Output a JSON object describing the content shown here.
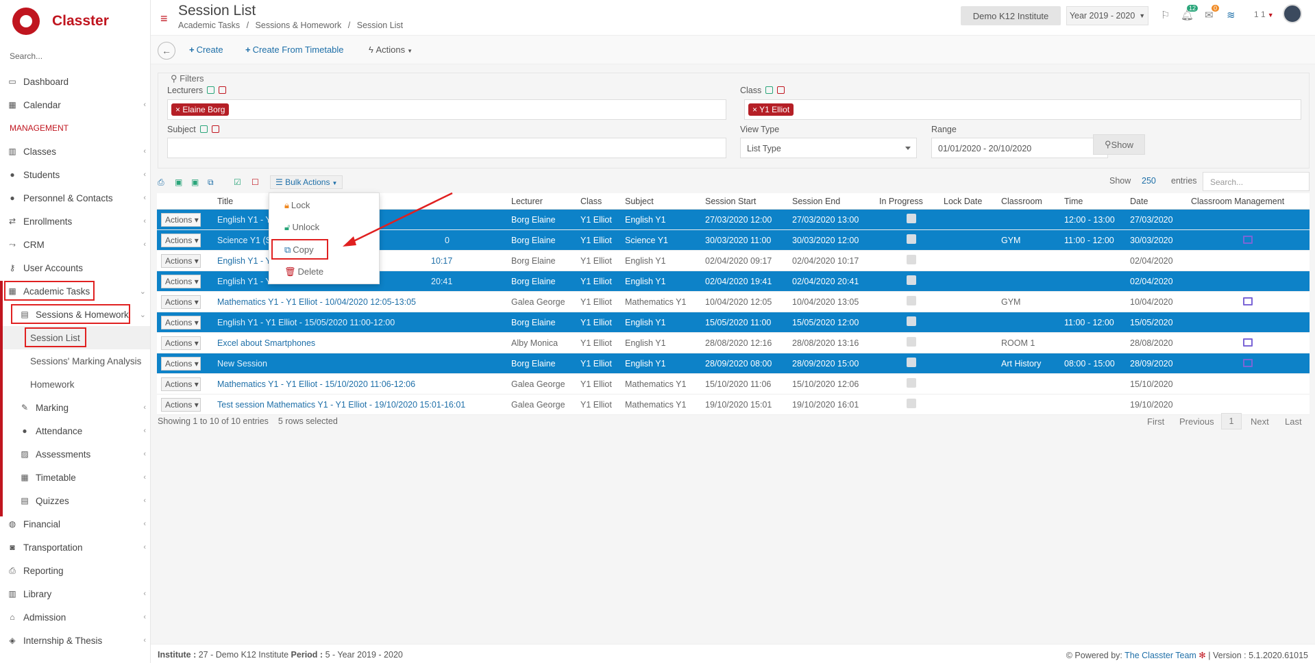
{
  "brand": {
    "name": "Classter",
    "search_placeholder": "Search...",
    "accent": "#c0151f"
  },
  "sidebar": {
    "dashboard": "Dashboard",
    "calendar": "Calendar",
    "section": "MANAGEMENT",
    "classes": "Classes",
    "students": "Students",
    "personnel": "Personnel & Contacts",
    "enrollments": "Enrollments",
    "crm": "CRM",
    "user_accounts": "User Accounts",
    "academic_tasks": "Academic Tasks",
    "sessions_homework": "Sessions & Homework",
    "session_list": "Session List",
    "marking_analysis": "Sessions' Marking Analysis",
    "homework": "Homework",
    "marking": "Marking",
    "attendance": "Attendance",
    "assessments": "Assessments",
    "timetable": "Timetable",
    "quizzes": "Quizzes",
    "financial": "Financial",
    "transportation": "Transportation",
    "reporting": "Reporting",
    "library": "Library",
    "admission": "Admission",
    "internship": "Internship & Thesis"
  },
  "header": {
    "title": "Session List",
    "breadcrumbs": [
      "Academic Tasks",
      "/",
      "Sessions & Homework",
      "/",
      "Session List"
    ],
    "institute": "Demo K12 Institute",
    "year": "Year 2019 - 2020",
    "notif_count": "12",
    "msg_count": "0",
    "user": "1 1"
  },
  "toolbar": {
    "create": "Create",
    "create_from_timetable": "Create From Timetable",
    "actions": "Actions"
  },
  "filters": {
    "title": "Filters",
    "lecturers_label": "Lecturers",
    "lecturer_tag": "Elaine Borg",
    "class_label": "Class",
    "class_tag": "Y1 Elliot",
    "subject_label": "Subject",
    "view_type_label": "View Type",
    "view_type_value": "List Type",
    "range_label": "Range",
    "range_value": "01/01/2020 - 20/10/2020",
    "show_button": "Show"
  },
  "table_tools": {
    "bulk_actions": "Bulk Actions",
    "show": "Show",
    "page_size": "250",
    "entries": "entries",
    "search_placeholder": "Search..."
  },
  "bulk_menu": [
    "Lock",
    "Unlock",
    "Copy",
    "Delete"
  ],
  "columns": [
    "Title",
    "Lecturer",
    "Class",
    "Subject",
    "Session Start",
    "Session End",
    "In Progress",
    "Lock Date",
    "Classroom",
    "Time",
    "Date",
    "Classroom Management"
  ],
  "rows": [
    {
      "sel": true,
      "title": "English Y1 - Y",
      "lecturer": "Borg Elaine",
      "class": "Y1 Elliot",
      "subject": "English Y1",
      "start": "27/03/2020 12:00",
      "end": "27/03/2020 13:00",
      "classroom": "",
      "time": "12:00 - 13:00",
      "date": "27/03/2020",
      "cm": false
    },
    {
      "sel": true,
      "title": "Science Y1 (S",
      "title_tail": "0",
      "lecturer": "Borg Elaine",
      "class": "Y1 Elliot",
      "subject": "Science Y1",
      "start": "30/03/2020 11:00",
      "end": "30/03/2020 12:00",
      "classroom": "GYM",
      "time": "11:00 - 12:00",
      "date": "30/03/2020",
      "cm": true
    },
    {
      "sel": false,
      "title": "English Y1 - Y",
      "title_tail": "10:17",
      "lecturer": "Borg Elaine",
      "class": "Y1 Elliot",
      "subject": "English Y1",
      "start": "02/04/2020 09:17",
      "end": "02/04/2020 10:17",
      "classroom": "",
      "time": "",
      "date": "02/04/2020",
      "cm": false
    },
    {
      "sel": true,
      "title": "English Y1 - Y",
      "title_tail": "20:41",
      "lecturer": "Borg Elaine",
      "class": "Y1 Elliot",
      "subject": "English Y1",
      "start": "02/04/2020 19:41",
      "end": "02/04/2020 20:41",
      "classroom": "",
      "time": "",
      "date": "02/04/2020",
      "cm": false
    },
    {
      "sel": false,
      "title": "Mathematics Y1 - Y1 Elliot - 10/04/2020 12:05-13:05",
      "lecturer": "Galea George",
      "class": "Y1 Elliot",
      "subject": "Mathematics Y1",
      "start": "10/04/2020 12:05",
      "end": "10/04/2020 13:05",
      "classroom": "GYM",
      "time": "",
      "date": "10/04/2020",
      "cm": true
    },
    {
      "sel": true,
      "title": "English Y1 - Y1 Elliot - 15/05/2020 11:00-12:00",
      "lecturer": "Borg Elaine",
      "class": "Y1 Elliot",
      "subject": "English Y1",
      "start": "15/05/2020 11:00",
      "end": "15/05/2020 12:00",
      "classroom": "",
      "time": "11:00 - 12:00",
      "date": "15/05/2020",
      "cm": false
    },
    {
      "sel": false,
      "title": "Excel about Smartphones",
      "lecturer": "Alby Monica",
      "class": "Y1 Elliot",
      "subject": "English Y1",
      "start": "28/08/2020 12:16",
      "end": "28/08/2020 13:16",
      "classroom": "ROOM 1",
      "time": "",
      "date": "28/08/2020",
      "cm": true
    },
    {
      "sel": true,
      "title": "New Session",
      "lecturer": "Borg Elaine",
      "class": "Y1 Elliot",
      "subject": "English Y1",
      "start": "28/09/2020 08:00",
      "end": "28/09/2020 15:00",
      "classroom": "Art History",
      "time": "08:00 - 15:00",
      "date": "28/09/2020",
      "cm": true
    },
    {
      "sel": false,
      "title": "Mathematics Y1 - Y1 Elliot - 15/10/2020 11:06-12:06",
      "lecturer": "Galea George",
      "class": "Y1 Elliot",
      "subject": "Mathematics Y1",
      "start": "15/10/2020 11:06",
      "end": "15/10/2020 12:06",
      "classroom": "",
      "time": "",
      "date": "15/10/2020",
      "cm": false
    },
    {
      "sel": false,
      "title": "Test session Mathematics Y1 - Y1 Elliot - 19/10/2020 15:01-16:01",
      "lecturer": "Galea George",
      "class": "Y1 Elliot",
      "subject": "Mathematics Y1",
      "start": "19/10/2020 15:01",
      "end": "19/10/2020 16:01",
      "classroom": "",
      "time": "",
      "date": "19/10/2020",
      "cm": false
    }
  ],
  "row_action_label": "Actions",
  "table_info": {
    "showing": "Showing 1 to 10 of 10 entries",
    "selected": "5 rows selected"
  },
  "pager": {
    "first": "First",
    "previous": "Previous",
    "current": "1",
    "next": "Next",
    "last": "Last"
  },
  "footer": {
    "left_label1": "Institute :",
    "left_val1": "27 - Demo K12 Institute",
    "left_label2": "Period :",
    "left_val2": "5 - Year 2019 - 2020",
    "powered": "Powered by:",
    "team": "The Classter Team",
    "version": "| Version : 5.1.2020.61015"
  }
}
